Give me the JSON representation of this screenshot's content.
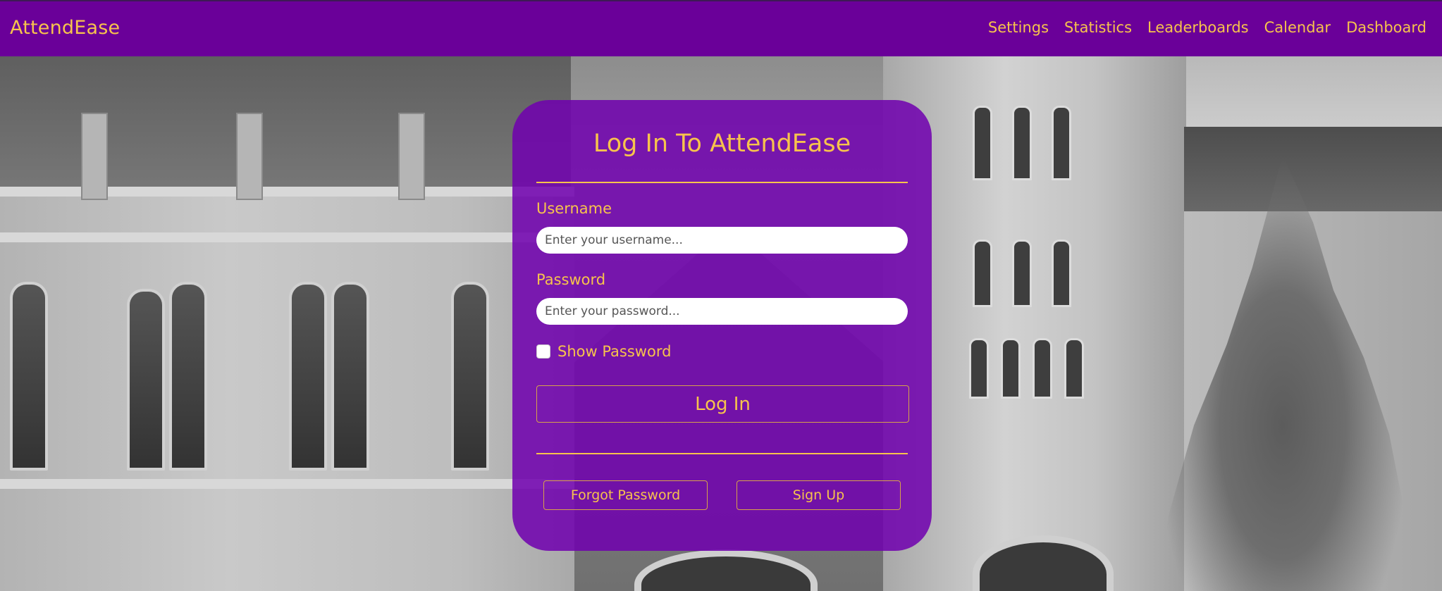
{
  "nav": {
    "brand": "AttendEase",
    "links": [
      "Settings",
      "Statistics",
      "Leaderboards",
      "Calendar",
      "Dashboard"
    ]
  },
  "login": {
    "title": "Log In To AttendEase",
    "username_label": "Username",
    "username_placeholder": "Enter your username...",
    "password_label": "Password",
    "password_placeholder": "Enter your password...",
    "show_password_label": "Show Password",
    "show_password_checked": false,
    "login_button": "Log In",
    "forgot_password_button": "Forgot Password",
    "sign_up_button": "Sign Up"
  },
  "colors": {
    "nav_bg": "#6a0099",
    "accent": "#f7c34c",
    "card_bg": "#7000af"
  },
  "background": "campus-building-photo"
}
